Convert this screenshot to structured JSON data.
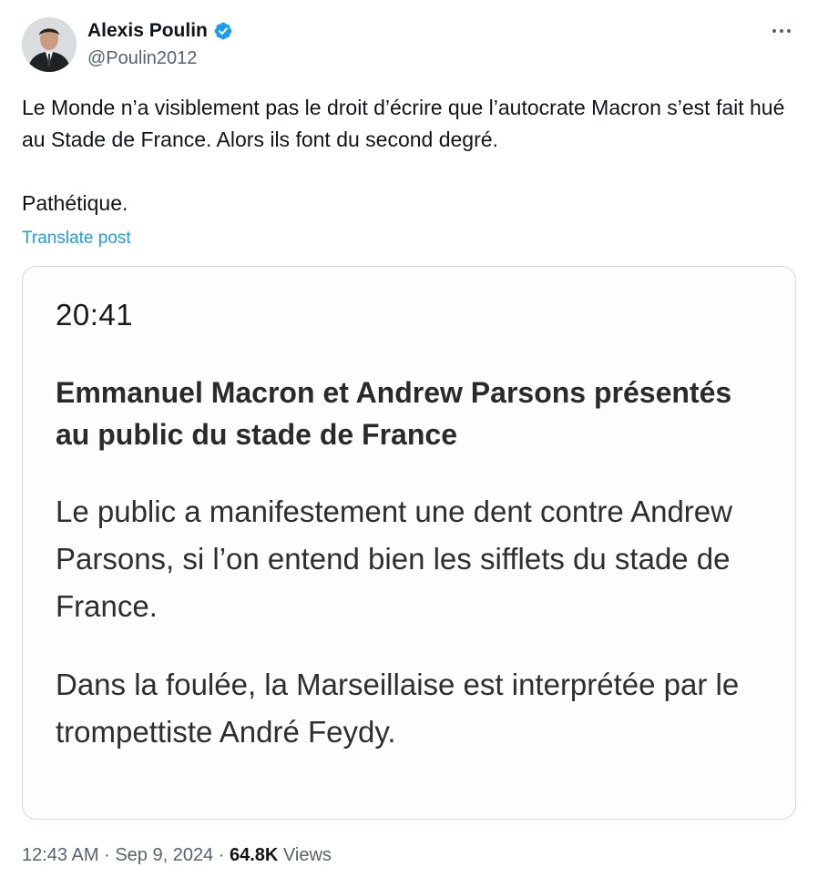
{
  "author": {
    "name": "Alexis Poulin",
    "handle": "@Poulin2012",
    "verified": true,
    "verified_color": "#1d9bf0"
  },
  "menu": {
    "icon": "more-horizontal-icon"
  },
  "tweet": {
    "paragraphs": [
      "Le Monde n’a visiblement pas le droit d’écrire que l’autocrate Macron s’est fait hué au Stade de France. Alors ils font du second degré.",
      "Pathétique."
    ],
    "translate_label": "Translate post"
  },
  "media": {
    "time": "20:41",
    "headline": "Emmanuel Macron et Andrew Parsons présentés au public du stade de France",
    "paragraphs": [
      "Le public a manifestement une dent contre Andrew Parsons, si l’on entend bien les sifflets du stade de France.",
      "Dans la foulée, la Marseillaise est interprétée par le trompettiste André Feydy."
    ]
  },
  "meta": {
    "time": "12:43 AM",
    "separator": "·",
    "date": "Sep 9, 2024",
    "views_count": "64.8K",
    "views_label": "Views"
  },
  "colors": {
    "text": "#0f1419",
    "secondary": "#536471",
    "link": "#1d9bf0",
    "border": "#cfd9de"
  }
}
